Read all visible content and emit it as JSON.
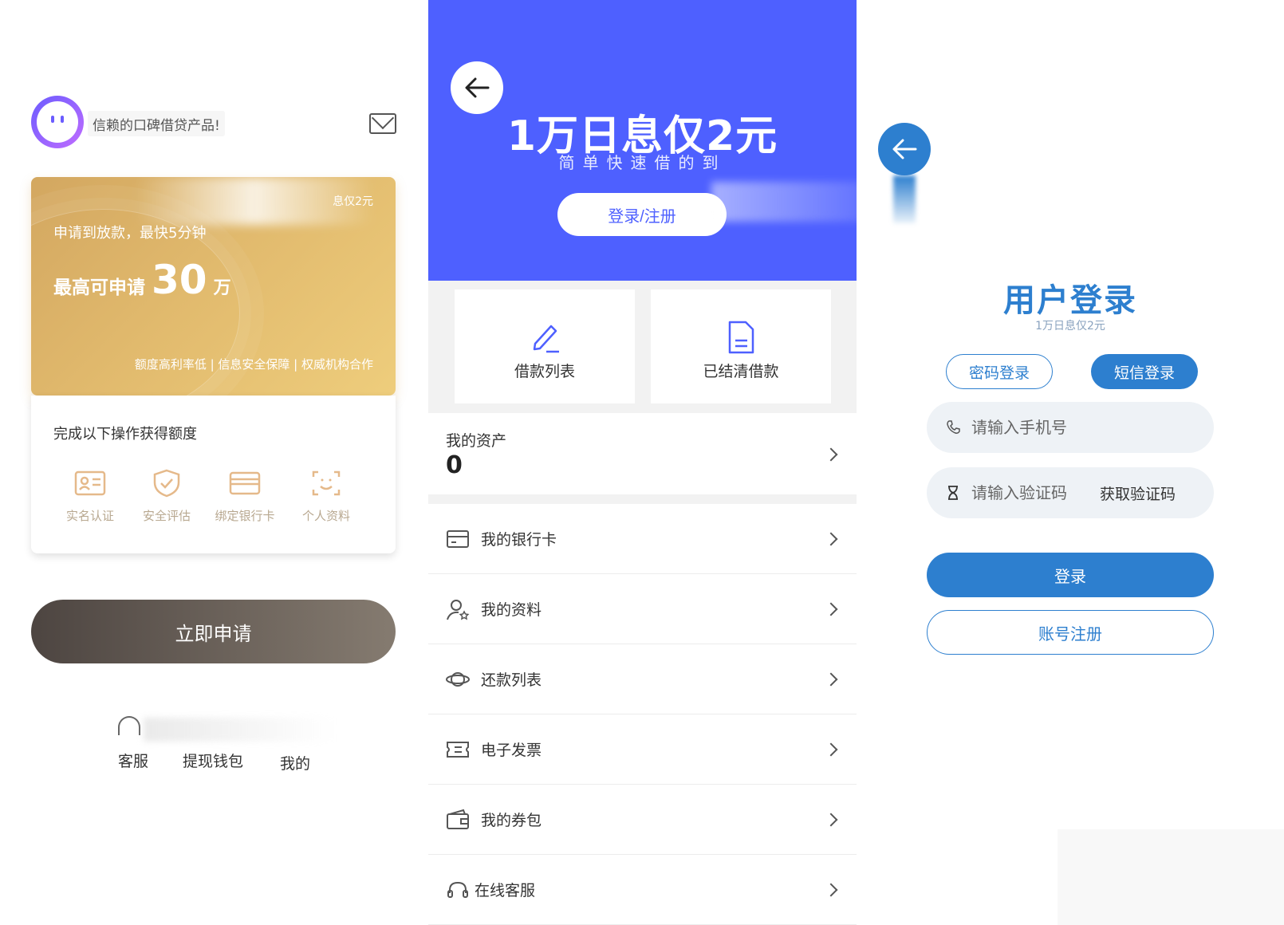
{
  "left": {
    "slogan": "信赖的口碑借贷产品!",
    "card": {
      "tag": "息仅2元",
      "sub": "申请到放款，最快5分钟",
      "max_label": "最高可申请",
      "max_amount": "30",
      "max_unit": "万",
      "features": "额度高利率低 | 信息安全保障 | 权威机构合作"
    },
    "steps_title": "完成以下操作获得额度",
    "steps": [
      "实名认证",
      "安全评估",
      "绑定银行卡",
      "个人资料"
    ],
    "apply_label": "立即申请",
    "nav": [
      "客服",
      "提现钱包",
      "我的"
    ]
  },
  "mid": {
    "hero_title": "1万日息仅2元",
    "hero_sub": "简单快速借的到",
    "login_reg": "登录/注册",
    "tiles": [
      "借款列表",
      "已结清借款"
    ],
    "asset_label": "我的资产",
    "asset_value": "0",
    "menu": [
      "我的银行卡",
      "我的资料",
      "还款列表",
      "电子发票",
      "我的券包",
      "在线客服"
    ]
  },
  "right": {
    "title": "用户登录",
    "subtitle": "1万日息仅2元",
    "tab_password": "密码登录",
    "tab_sms": "短信登录",
    "phone_placeholder": "请输入手机号",
    "code_placeholder": "请输入验证码",
    "get_code": "获取验证码",
    "login": "登录",
    "register": "账号注册"
  },
  "colors": {
    "mid_hero": "#4e60ff",
    "login_blue": "#2d7fcf",
    "gold": "#e2bb6e"
  }
}
